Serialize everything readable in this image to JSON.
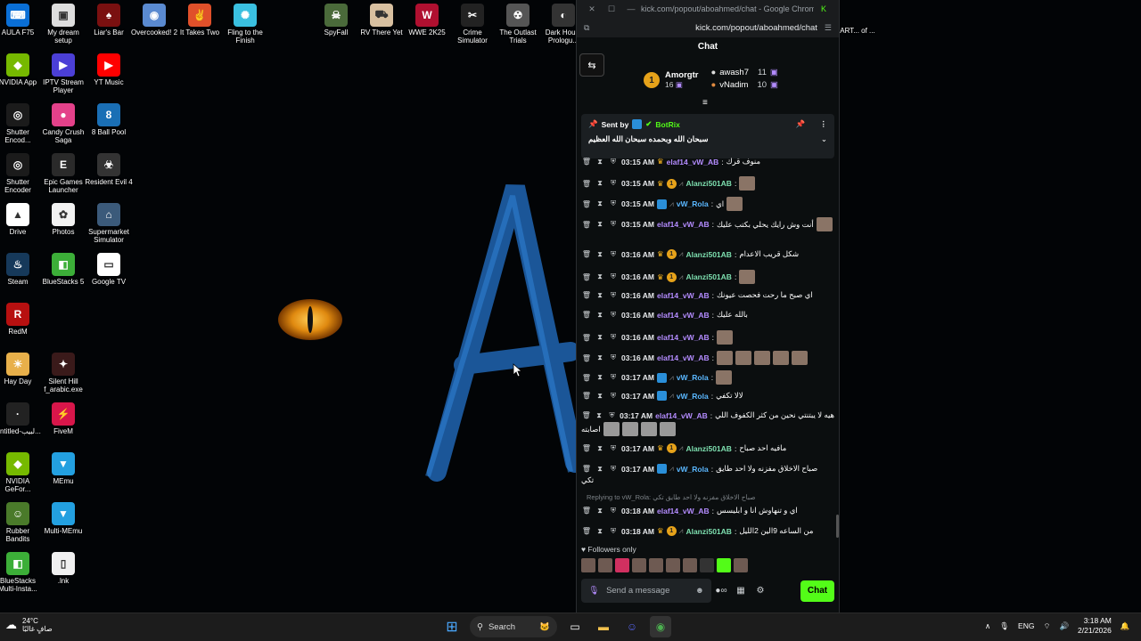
{
  "desktop": {
    "icons_col1": [
      {
        "label": "AULA F75",
        "color": "#0a6fd6",
        "glyph": "⌨"
      },
      {
        "label": "NVIDIA App",
        "color": "#76b900",
        "glyph": "◆"
      },
      {
        "label": "Shutter Encod...",
        "color": "#1b1b1b",
        "glyph": "◎"
      },
      {
        "label": "Shutter Encoder",
        "color": "#1b1b1b",
        "glyph": "◎"
      },
      {
        "label": "Drive",
        "color": "#ffffff",
        "glyph": "▲"
      },
      {
        "label": "Steam",
        "color": "#16395a",
        "glyph": "♨"
      },
      {
        "label": "RedM",
        "color": "#b71010",
        "glyph": "R"
      },
      {
        "label": "Hay Day",
        "color": "#e8b04a",
        "glyph": "☀"
      },
      {
        "label": "Untitled-لبيب...",
        "color": "#222",
        "glyph": "·"
      },
      {
        "label": "NVIDIA GeFor...",
        "color": "#76b900",
        "glyph": "◆"
      },
      {
        "label": "Rubber Bandits",
        "color": "#4a7a2a",
        "glyph": "☺"
      },
      {
        "label": "BlueStacks Multi-Insta...",
        "color": "#3cae38",
        "glyph": "◧"
      }
    ],
    "icons_col2": [
      {
        "label": "My dream setup",
        "color": "#ddd",
        "glyph": "▣"
      },
      {
        "label": "IPTV Stream Player",
        "color": "#4b3fd6",
        "glyph": "▶"
      },
      {
        "label": "Candy Crush Saga",
        "color": "#e4418a",
        "glyph": "●"
      },
      {
        "label": "Epic Games Launcher",
        "color": "#2a2a2a",
        "glyph": "E"
      },
      {
        "label": "Photos",
        "color": "#f2f2f2",
        "glyph": "✿"
      },
      {
        "label": "BlueStacks 5",
        "color": "#3cae38",
        "glyph": "◧"
      },
      {
        "label": "Silent Hill f_arabic.exe",
        "color": "#3a1a1a",
        "glyph": "✦"
      },
      {
        "label": "FiveM",
        "color": "#d8164a",
        "glyph": "⚡"
      },
      {
        "label": "MEmu",
        "color": "#23a0e0",
        "glyph": "▼"
      },
      {
        "label": "Multi-MEmu",
        "color": "#23a0e0",
        "glyph": "▼"
      },
      {
        "label": ".lnk",
        "color": "#f0f0f0",
        "glyph": "▯"
      }
    ],
    "icons_col3": [
      {
        "label": "Liar's Bar",
        "color": "#7a1010",
        "glyph": "♠"
      },
      {
        "label": "YT Music",
        "color": "#ff0000",
        "glyph": "▶"
      },
      {
        "label": "8 Ball Pool",
        "color": "#1a6fb5",
        "glyph": "8"
      },
      {
        "label": "Resident Evil 4",
        "color": "#333",
        "glyph": "☣"
      },
      {
        "label": "Supermarket Simulator",
        "color": "#3b5a7a",
        "glyph": "⌂"
      },
      {
        "label": "Google TV",
        "color": "#ffffff",
        "glyph": "▭"
      }
    ],
    "icons_top": [
      {
        "label": "Overcooked! 2",
        "color": "#5a8ad0",
        "glyph": "◉"
      },
      {
        "label": "It Takes Two",
        "color": "#e0502a",
        "glyph": "✌"
      },
      {
        "label": "Fling to the Finish",
        "color": "#3ac0e0",
        "glyph": "✺"
      },
      {
        "label": "SpyFall",
        "color": "#4a6a3a",
        "glyph": "☠"
      },
      {
        "label": "RV There Yet",
        "color": "#d8c0a0",
        "glyph": "⛟"
      },
      {
        "label": "WWE 2K25",
        "color": "#b01030",
        "glyph": "W"
      },
      {
        "label": "Crime Simulator",
        "color": "#222",
        "glyph": "✂"
      },
      {
        "label": "The Outlast Trials",
        "color": "#555",
        "glyph": "☢"
      },
      {
        "label": "Dark Hou... Prologu...",
        "color": "#333",
        "glyph": "◐"
      }
    ],
    "partial_right_label": "ART... of ..."
  },
  "browser": {
    "title": "kick.com/popout/aboahmed/chat - Google Chrome",
    "url": "kick.com/popout/aboahmed/chat",
    "chat_title": "Chat"
  },
  "leaderboard": {
    "first_name": "Amorgtr",
    "first_count": "16",
    "second_name": "awash7",
    "second_count": "11",
    "third_name": "vNadim",
    "third_count": "10"
  },
  "pinned": {
    "sent_by_label": "Sent by",
    "sender": "BotRix",
    "message": "سبحان الله وبحمده سبحان الله العظيم"
  },
  "messages": [
    {
      "time": "03:15 AM",
      "user": "elaf14_vW_AB",
      "cls": "u-purple",
      "badges": "crown",
      "text": "منوف قرك"
    },
    {
      "time": "03:15 AM",
      "user": "Alanzi501AB",
      "cls": "u-teal",
      "badges": "crown-coin",
      "text": "",
      "emotes": 1
    },
    {
      "time": "03:15 AM",
      "user": "vW_Rola",
      "cls": "u-blue",
      "badges": "blue",
      "text": "اي",
      "emotes": 1
    },
    {
      "time": "03:15 AM",
      "user": "elaf14_vW_AB",
      "cls": "u-purple",
      "badges": "",
      "text": "أنت وش رايك يحلي بكتب عليك",
      "emotes": 1
    },
    {
      "time": "03:16 AM",
      "user": "Alanzi501AB",
      "cls": "u-teal",
      "badges": "crown-coin",
      "text": "شكل قريب الاعدام"
    },
    {
      "time": "03:16 AM",
      "user": "Alanzi501AB",
      "cls": "u-teal",
      "badges": "crown-coin",
      "text": "",
      "emotes": 1
    },
    {
      "time": "03:16 AM",
      "user": "elaf14_vW_AB",
      "cls": "u-purple",
      "badges": "",
      "text": "اي صبح ما رحت فحصت عيونك"
    },
    {
      "time": "03:16 AM",
      "user": "elaf14_vW_AB",
      "cls": "u-purple",
      "badges": "",
      "text": "بالله عليك"
    },
    {
      "time": "03:16 AM",
      "user": "elaf14_vW_AB",
      "cls": "u-purple",
      "badges": "",
      "text": "",
      "emotes": 1
    },
    {
      "time": "03:16 AM",
      "user": "elaf14_vW_AB",
      "cls": "u-purple",
      "badges": "",
      "text": "",
      "emotes": 5
    },
    {
      "time": "03:17 AM",
      "user": "vW_Rola",
      "cls": "u-blue",
      "badges": "blue",
      "text": "",
      "emotes": 1
    },
    {
      "time": "03:17 AM",
      "user": "vW_Rola",
      "cls": "u-blue",
      "badges": "blue",
      "text": "لالا تكفي"
    },
    {
      "time": "03:17 AM",
      "user": "elaf14_vW_AB",
      "cls": "u-purple",
      "badges": "",
      "text": "هيه لا يبتنتي نحين من كثر الكفوف اللي"
    },
    {
      "time": "03:17 AM",
      "user": "Alanzi501AB",
      "cls": "u-teal",
      "badges": "crown-coin",
      "text": "مافيه احد صباح"
    },
    {
      "time": "03:17 AM",
      "user": "vW_Rola",
      "cls": "u-blue",
      "badges": "blue",
      "text": "صباح الاخلاق مفزنه ولا احد طايق"
    },
    {
      "time": "03:18 AM",
      "user": "elaf14_vW_AB",
      "cls": "u-purple",
      "badges": "",
      "text": "اي و تنهاوش انا و ابليسس"
    },
    {
      "time": "03:18 AM",
      "user": "Alanzi501AB",
      "cls": "u-teal",
      "badges": "crown-coin",
      "text": "من الساعه 9الين 2الليل"
    }
  ],
  "extra_lines": {
    "wrap_after_12": "اصابته",
    "wrap_after_14": "تكي",
    "reply_text": "Replying to vW_Rola: صباح الاخلاق مفزنه ولا احد طايق تكي"
  },
  "footer": {
    "followers_only": "Followers only",
    "input_placeholder": "Send a message",
    "chat_button": "Chat"
  },
  "taskbar": {
    "temperature": "24°C",
    "weather_text": "صافٍ غالبًا",
    "search_label": "Search",
    "lang": "ENG",
    "time": "3:18 AM",
    "date": "2/21/2026"
  },
  "colors": {
    "kick_green": "#53fc18",
    "gold": "#e6a21a"
  }
}
